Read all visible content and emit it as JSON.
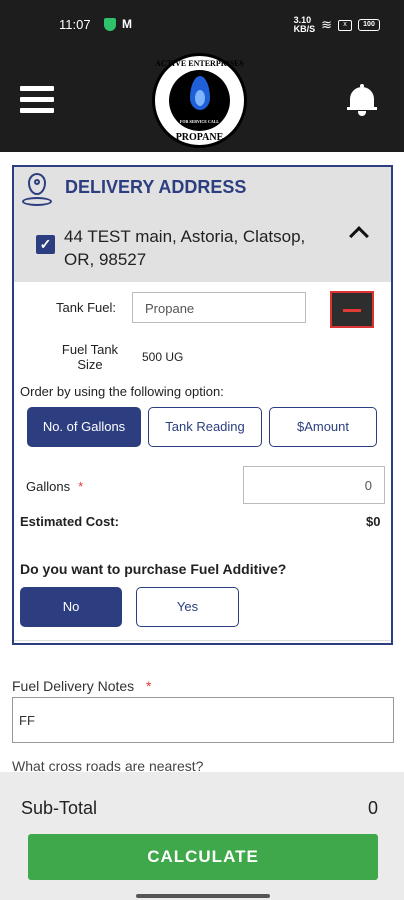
{
  "status_bar": {
    "time": "11:07",
    "speed": "3.10 KB/S",
    "battery": "100"
  },
  "logo": {
    "top_text": "ACTIVE ENTERPRISES",
    "bottom_text": "PROPANE",
    "inner_text": "FOR SERVICE CALL"
  },
  "delivery": {
    "title": "DELIVERY ADDRESS",
    "address": "44 TEST main, Astoria, Clatsop, OR, 98527",
    "checked": true
  },
  "tank": {
    "fuel_label": "Tank Fuel:",
    "fuel_value": "Propane",
    "size_label": "Fuel Tank Size",
    "size_value": "500 UG"
  },
  "order": {
    "label": "Order by using the following option:",
    "options": [
      "No. of Gallons",
      "Tank Reading",
      "$Amount"
    ],
    "selected": "No. of Gallons"
  },
  "gallons": {
    "label": "Gallons",
    "required_mark": "*",
    "value": "0"
  },
  "estimated_cost": {
    "label": "Estimated Cost:",
    "value": "$0"
  },
  "fuel_additive": {
    "question": "Do you want to purchase Fuel Additive?",
    "no": "No",
    "yes": "Yes",
    "selected": "No"
  },
  "notes": {
    "label": "Fuel Delivery Notes",
    "required_mark": "*",
    "value": "FF"
  },
  "cross_roads": {
    "label": "What cross roads are nearest?"
  },
  "footer": {
    "subtotal_label": "Sub-Total",
    "subtotal_value": "0",
    "calculate_label": "CALCULATE"
  },
  "colors": {
    "header_bg": "#1d1d1d",
    "primary": "#2c3e80",
    "accent_green": "#3fa84a",
    "danger": "#e53935"
  }
}
